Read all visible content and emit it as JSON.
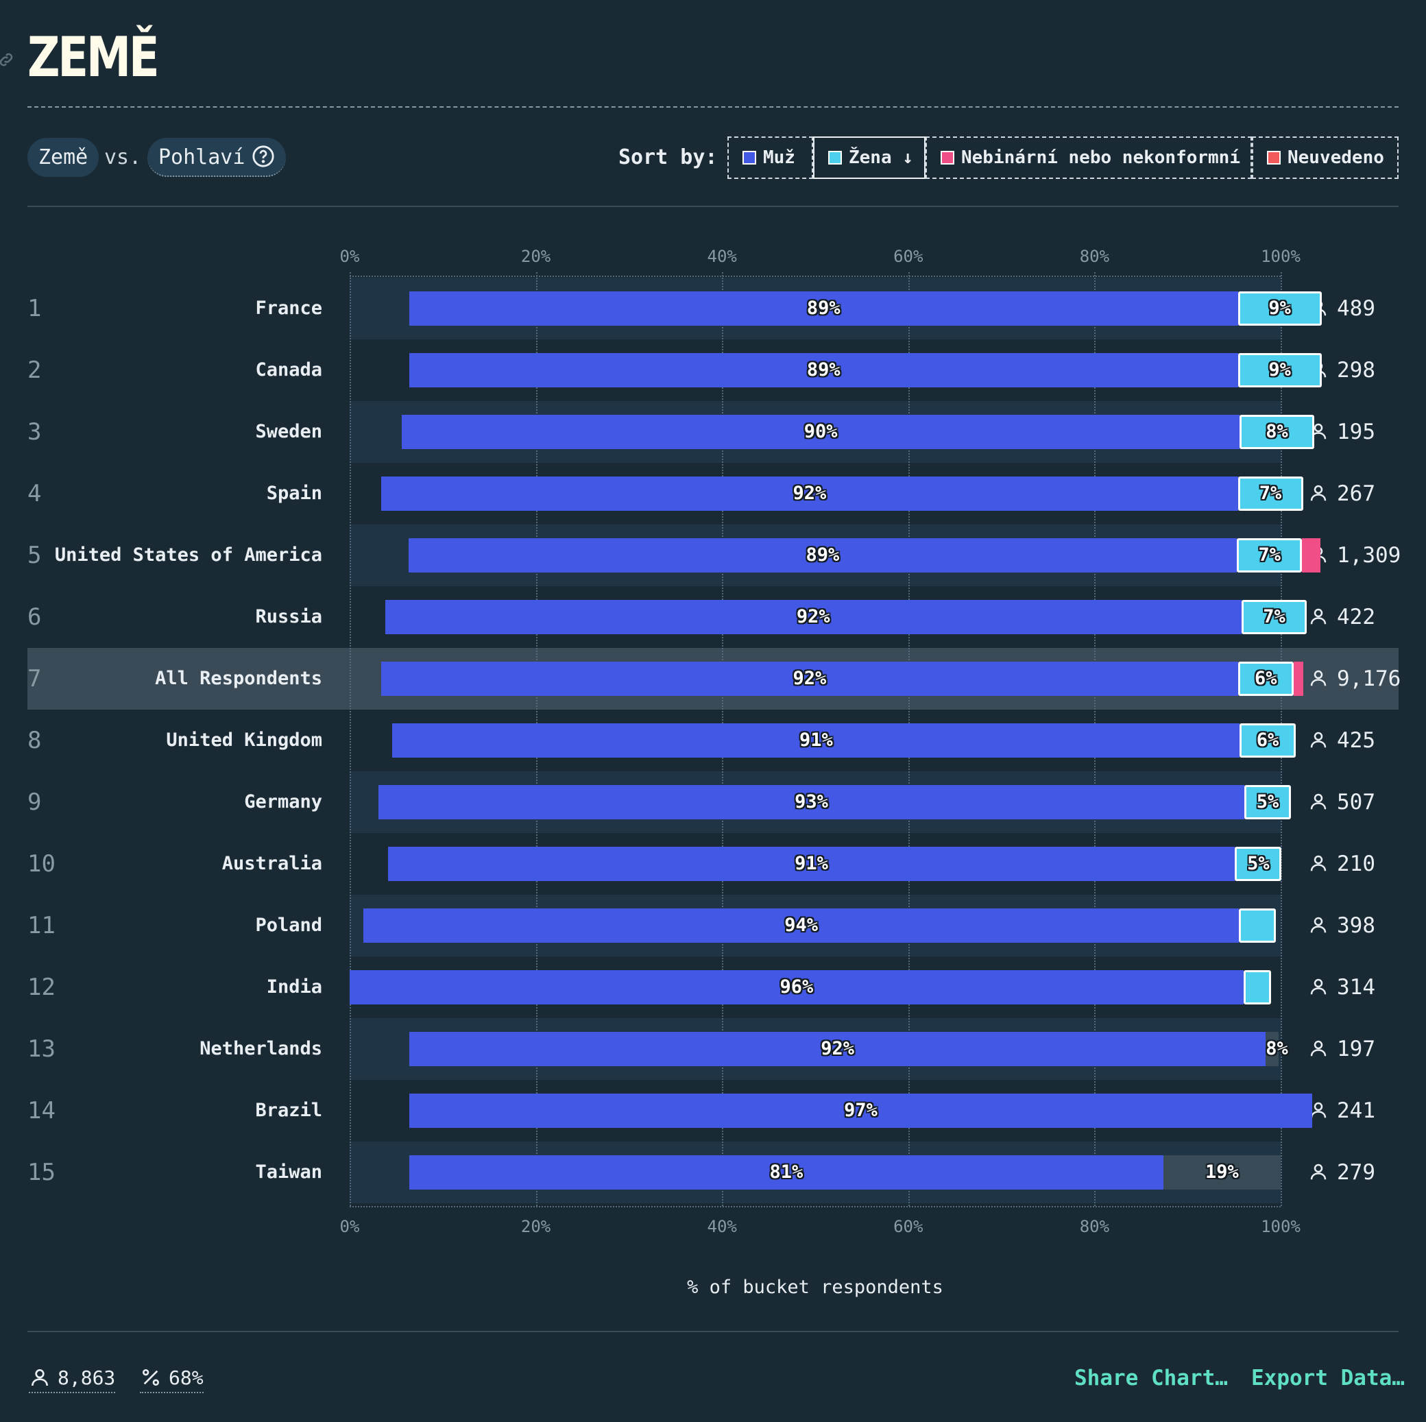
{
  "title": "ZEMĚ",
  "controls": {
    "dimension": "Země",
    "vs": "vs.",
    "compare": "Pohlaví",
    "sort_label": "Sort by:",
    "sort_options": [
      {
        "label": "Muž",
        "color": "#4359e6"
      },
      {
        "label": "Žena ↓",
        "color": "#4cd0ee",
        "active": true
      },
      {
        "label": "Nebinární nebo nekonformní",
        "color": "#ef4f86"
      },
      {
        "label": "Neuvedeno",
        "color": "#f05a5a"
      }
    ]
  },
  "chart_data": {
    "type": "bar",
    "stacked": true,
    "orientation": "horizontal",
    "xlabel": "% of bucket respondents",
    "xlim": [
      0,
      100
    ],
    "ticks": [
      "0%",
      "20%",
      "40%",
      "60%",
      "80%",
      "100%"
    ],
    "series": [
      {
        "name": "Muž",
        "color": "#4359e6"
      },
      {
        "name": "Žena",
        "color": "#4cd0ee"
      },
      {
        "name": "Nebinární nebo nekonformní",
        "color": "#ef4f86"
      },
      {
        "name": "Neuvedeno",
        "color": "#f05a5a"
      }
    ],
    "rows": [
      {
        "rank": "1",
        "country": "France",
        "count": "489",
        "muz": 89,
        "zena": 9,
        "nb": 0,
        "muz_label": "89%",
        "zena_label": "9%",
        "start": 6.4,
        "end": 100
      },
      {
        "rank": "2",
        "country": "Canada",
        "count": "298",
        "muz": 89,
        "zena": 9,
        "nb": 0,
        "muz_label": "89%",
        "zena_label": "9%",
        "start": 6.4,
        "end": 99.8
      },
      {
        "rank": "3",
        "country": "Sweden",
        "count": "195",
        "muz": 90,
        "zena": 8,
        "nb": 0,
        "muz_label": "90%",
        "zena_label": "8%",
        "start": 5.6,
        "end": 99.1
      },
      {
        "rank": "4",
        "country": "Spain",
        "count": "267",
        "muz": 92,
        "zena": 7,
        "nb": 0,
        "muz_label": "92%",
        "zena_label": "7%",
        "start": 3.4,
        "end": 97.2
      },
      {
        "rank": "5",
        "country": "United States of America",
        "count": "1,309",
        "muz": 89,
        "zena": 7,
        "nb": 2,
        "muz_label": "89%",
        "zena_label": "7%",
        "start": 6.3,
        "end": 100.2
      },
      {
        "rank": "6",
        "country": "Russia",
        "count": "422",
        "muz": 92,
        "zena": 7,
        "nb": 0,
        "muz_label": "92%",
        "zena_label": "7%",
        "start": 3.8,
        "end": 96.8
      },
      {
        "rank": "7",
        "country": "All Respondents",
        "count": "9,176",
        "muz": 92,
        "zena": 6,
        "nb": 1,
        "muz_label": "92%",
        "zena_label": "6%",
        "start": 3.4,
        "end": 97.0,
        "highlight": true
      },
      {
        "rank": "8",
        "country": "United Kingdom",
        "count": "425",
        "muz": 91,
        "zena": 6,
        "nb": 0,
        "muz_label": "91%",
        "zena_label": "6%",
        "start": 4.6,
        "end": 98.3
      },
      {
        "rank": "9",
        "country": "Germany",
        "count": "507",
        "muz": 93,
        "zena": 5,
        "nb": 0,
        "muz_label": "93%",
        "zena_label": "5%",
        "start": 3.1,
        "end": 96.4
      },
      {
        "rank": "10",
        "country": "Australia",
        "count": "210",
        "muz": 91,
        "zena": 5,
        "nb": 0,
        "muz_label": "91%",
        "zena_label": "5%",
        "start": 4.1,
        "end": 97.7
      },
      {
        "rank": "11",
        "country": "Poland",
        "count": "398",
        "muz": 94,
        "zena": 4,
        "nb": 0,
        "muz_label": "94%",
        "zena_label": "",
        "start": 1.5,
        "end": 95.5
      },
      {
        "rank": "12",
        "country": "India",
        "count": "314",
        "muz": 96,
        "zena": 3,
        "nb": 0,
        "muz_label": "96%",
        "zena_label": "",
        "start": 0,
        "end": 94.0
      },
      {
        "rank": "13",
        "country": "Netherlands",
        "count": "197",
        "muz": 92,
        "zena": 0,
        "nb": 0,
        "muz_label": "92%",
        "zena_label": "",
        "rest_label": "8%",
        "start": 6.4,
        "end": 99.8
      },
      {
        "rank": "14",
        "country": "Brazil",
        "count": "241",
        "muz": 97,
        "zena": 0,
        "nb": 0,
        "muz_label": "97%",
        "zena_label": "",
        "rest_label": "",
        "start": 6.4,
        "end": 99.8
      },
      {
        "rank": "15",
        "country": "Taiwan",
        "count": "279",
        "muz": 81,
        "zena": 0,
        "nb": 0,
        "muz_label": "81%",
        "zena_label": "",
        "rest_label": "19%",
        "start": 6.4,
        "end": 100
      }
    ]
  },
  "footer": {
    "respondents": "8,863",
    "percent": "68%",
    "share": "Share Chart…",
    "export": "Export Data…"
  }
}
